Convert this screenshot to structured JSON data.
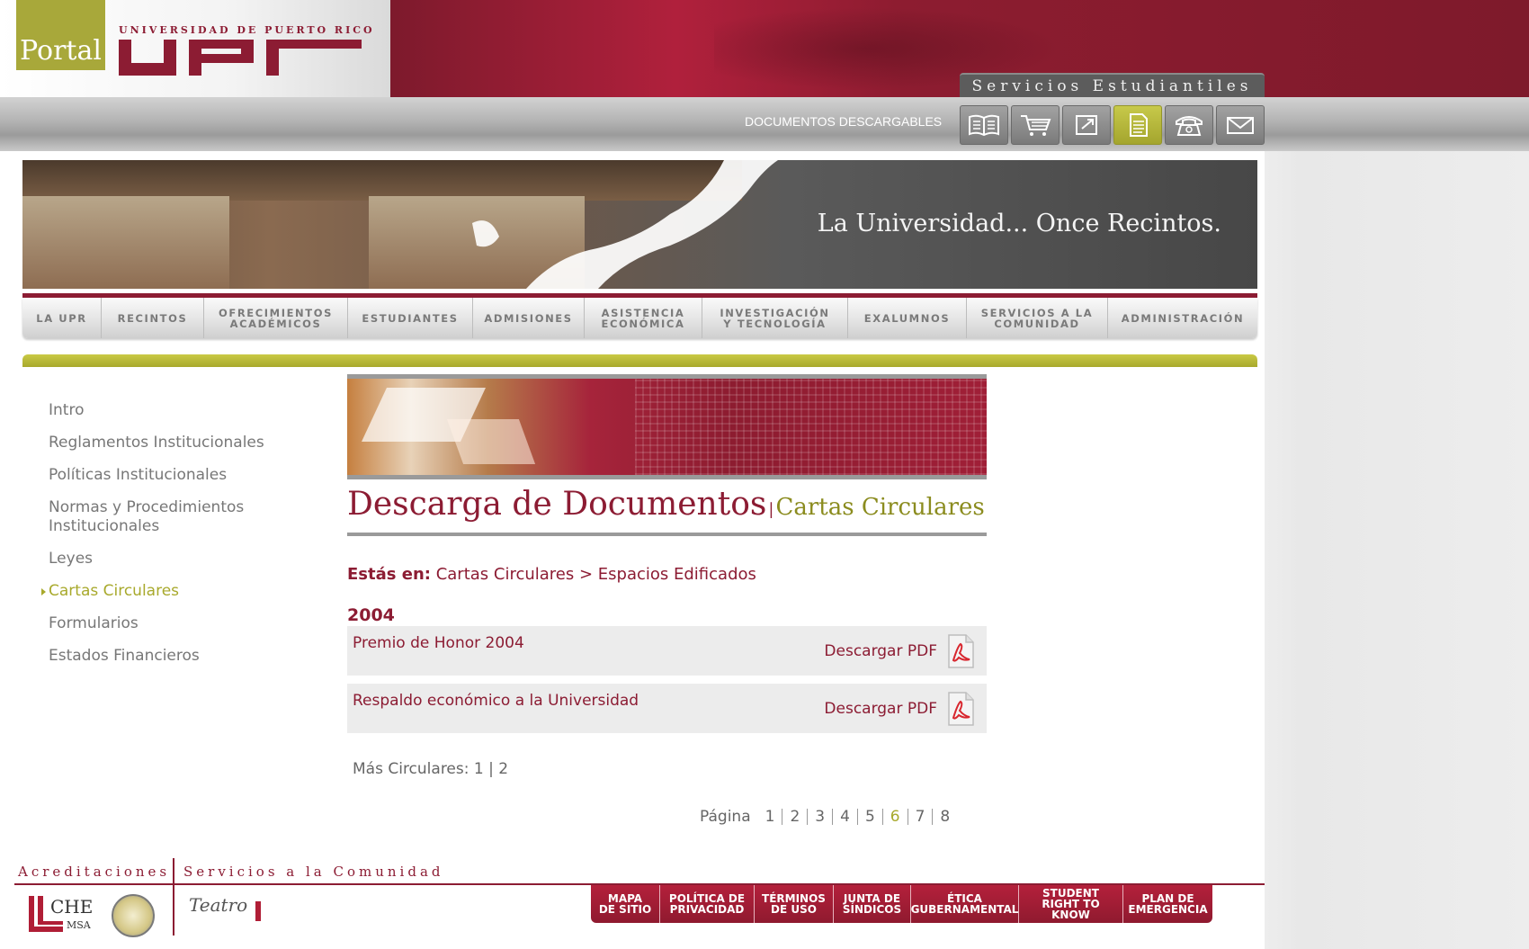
{
  "header": {
    "portal_label": "Portal",
    "university_name": "UNIVERSIDAD DE PUERTO RICO",
    "logo_letters": "UPR",
    "services_tab": "Servicios Estudiantiles"
  },
  "toolbar": {
    "section_label": "DOCUMENTOS DESCARGABLES",
    "icons": [
      "book-icon",
      "cart-icon",
      "link-icon",
      "document-icon",
      "phone-icon",
      "mail-icon"
    ],
    "active_icon": "document-icon"
  },
  "hero": {
    "tagline": "La Universidad... Once Recintos."
  },
  "nav": {
    "items": [
      "LA UPR",
      "RECINTOS",
      "OFRECIMIENTOS\nACADÉMICOS",
      "ESTUDIANTES",
      "ADMISIONES",
      "ASISTENCIA\nECONÓMICA",
      "INVESTIGACIÓN\nY TECNOLOGÍA",
      "EXALUMNOS",
      "SERVICIOS A LA\nCOMUNIDAD",
      "ADMINISTRACIÓN"
    ]
  },
  "sidebar": {
    "items": [
      "Intro",
      "Reglamentos Institucionales",
      "Políticas Institucionales",
      "Normas y Procedimientos Institucionales",
      "Leyes",
      "Cartas Circulares",
      "Formularios",
      "Estados Financieros"
    ],
    "active": "Cartas Circulares"
  },
  "content": {
    "heading": "Descarga de Documentos",
    "heading_separator": "|",
    "subheading": "Cartas Circulares",
    "breadcrumb_label": "Estás en:",
    "breadcrumb_path": "Cartas Circulares > Espacios Edificados",
    "year": "2004",
    "documents": [
      {
        "title": "Premio de Honor 2004",
        "download_label": "Descargar PDF"
      },
      {
        "title": "Respaldo económico a la Universidad",
        "download_label": "Descargar PDF"
      }
    ],
    "more_label": "Más Circulares:",
    "more_pages": "1 | 2",
    "pager_label": "Página",
    "pages": [
      "1",
      "2",
      "3",
      "4",
      "5",
      "6",
      "7",
      "8"
    ],
    "current_page": "6"
  },
  "footer": {
    "acreditaciones_label": "Acreditaciones",
    "servicios_label": "Servicios a la Comunidad",
    "che_text": "CHE",
    "msa_text": "MSA",
    "teatro_text": "Teatro",
    "links": [
      "MAPA\nDE SITIO",
      "POLÍTICA DE\nPRIVACIDAD",
      "TÉRMINOS\nDE USO",
      "JUNTA DE\nSÍNDICOS",
      "ÉTICA\nGUBERNAMENTAL",
      "STUDENT\nRIGHT TO KNOW",
      "PLAN DE\nEMERGENCIA"
    ]
  },
  "colors": {
    "brand_maroon": "#8c1c33",
    "olive_accent": "#a8a92c",
    "text_gray": "#777777"
  }
}
